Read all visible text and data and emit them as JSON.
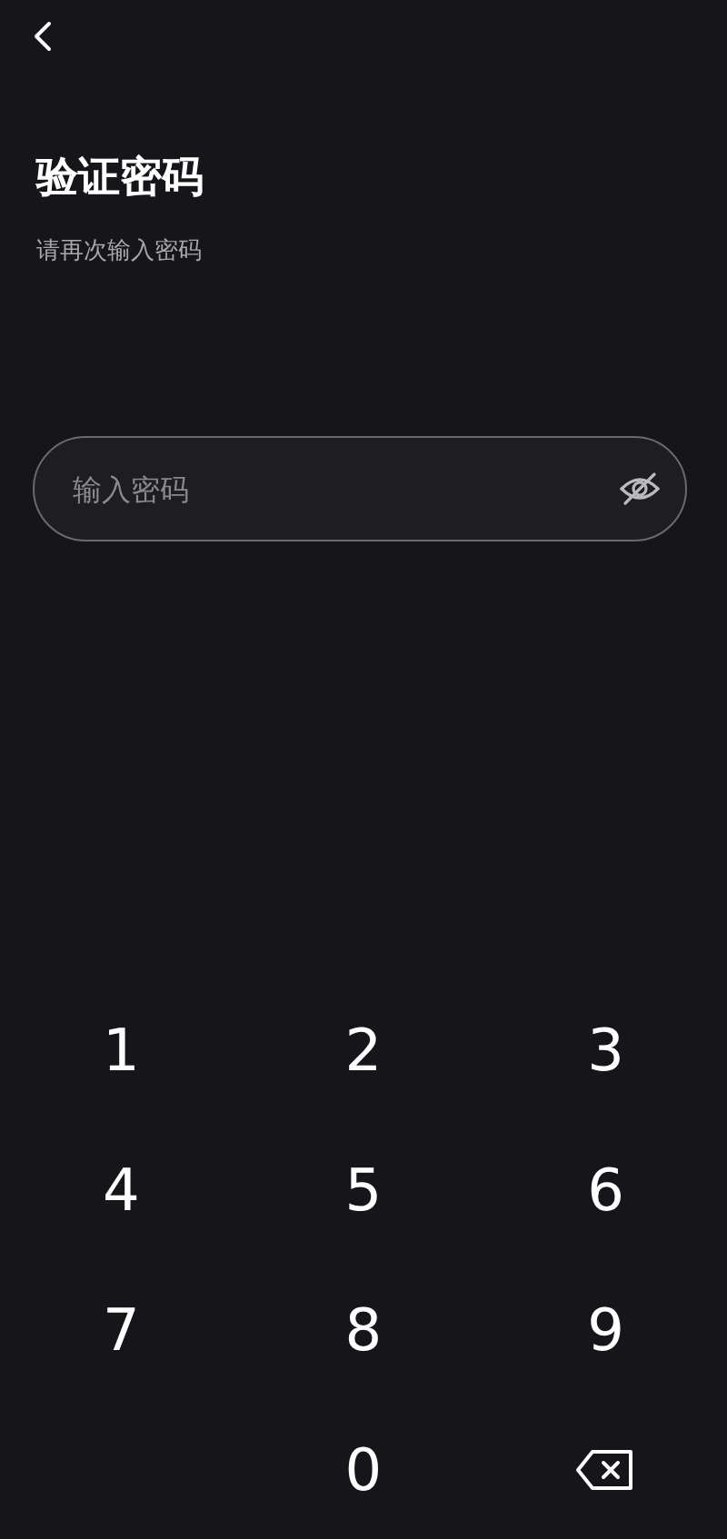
{
  "title": "验证密码",
  "subtitle": "请再次输入密码",
  "password_field": {
    "placeholder": "输入密码",
    "visible": false
  },
  "keypad": [
    {
      "kind": "digit",
      "label": "1"
    },
    {
      "kind": "digit",
      "label": "2"
    },
    {
      "kind": "digit",
      "label": "3"
    },
    {
      "kind": "digit",
      "label": "4"
    },
    {
      "kind": "digit",
      "label": "5"
    },
    {
      "kind": "digit",
      "label": "6"
    },
    {
      "kind": "digit",
      "label": "7"
    },
    {
      "kind": "digit",
      "label": "8"
    },
    {
      "kind": "digit",
      "label": "9"
    },
    {
      "kind": "empty"
    },
    {
      "kind": "digit",
      "label": "0"
    },
    {
      "kind": "backspace"
    }
  ]
}
